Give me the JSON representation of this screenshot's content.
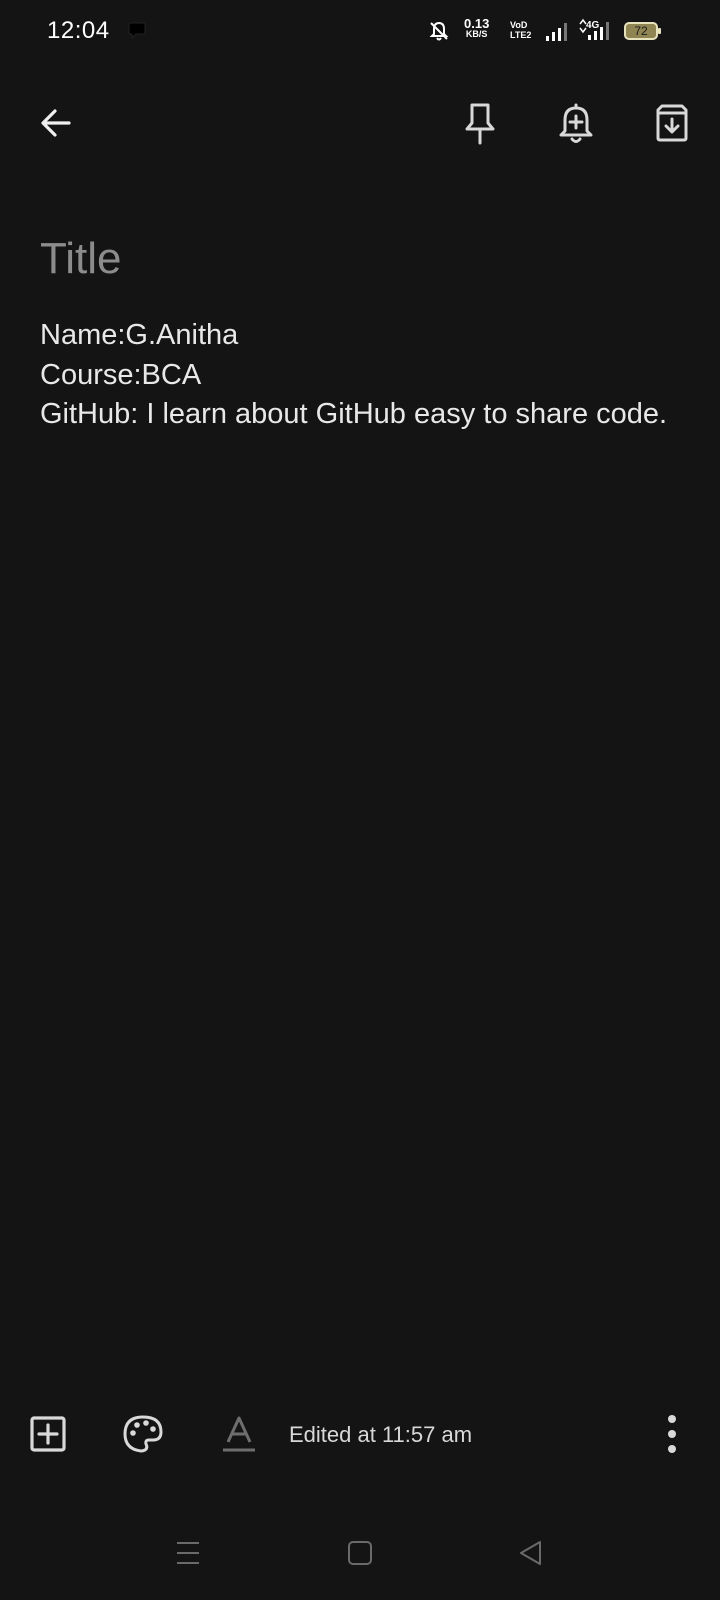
{
  "status_bar": {
    "time": "12:04",
    "net_speed_value": "0.13",
    "net_speed_unit": "KB/S",
    "volte_top": "VoD",
    "volte_bottom": "LTE2",
    "network_type": "4G",
    "battery_level": "72",
    "icons": [
      "message-icon",
      "bell-off-icon",
      "signal-icon",
      "signal-4g-icon",
      "battery-icon"
    ]
  },
  "toolbar": {
    "icons": [
      "back-arrow-icon",
      "pin-icon",
      "reminder-bell-icon",
      "archive-icon"
    ]
  },
  "note": {
    "title_placeholder": "Title",
    "lines": [
      "Name:G.Anitha",
      "Course:BCA",
      "GitHub: I learn about GitHub easy to share code."
    ]
  },
  "bottom_bar": {
    "edited_label": "Edited at 11:57 am",
    "icons": [
      "add-box-icon",
      "palette-icon",
      "text-format-icon",
      "more-vert-icon"
    ]
  },
  "nav_bar": {
    "icons": [
      "recents-menu-icon",
      "home-square-icon",
      "back-triangle-icon"
    ]
  },
  "colors": {
    "background": "#141414",
    "text": "#e8e8e8",
    "placeholder": "#8c8c8c",
    "icon": "#d9d9d9",
    "battery_fill": "#8f8553"
  }
}
